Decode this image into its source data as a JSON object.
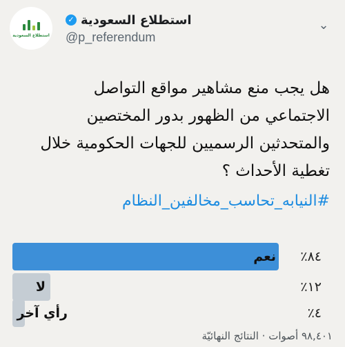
{
  "account": {
    "name": "استطلاع السعودية",
    "handle": "@p_referendum",
    "logo_text": "استطلاع السعودية",
    "verified_icon": "verified-badge-icon",
    "menu_icon": "chevron-down-icon"
  },
  "tweet": {
    "question_lines": [
      "هل يجب منع مشاهير مواقع التواصل",
      "الاجتماعي من الظهور بدور المختصين",
      "والمتحدثين الرسميين للجهات الحكومية خلال",
      "تغطية الأحداث ؟"
    ],
    "hashtag": "#النيابه_تحاسب_مخالفين_النظام"
  },
  "poll": {
    "options": [
      {
        "label": "نعم",
        "percent_label": "٨٤٪",
        "percent": 84,
        "winner": true
      },
      {
        "label": "لا",
        "percent_label": "١٢٪",
        "percent": 12,
        "winner": false
      },
      {
        "label": "رأي آخر",
        "percent_label": "٤٪",
        "percent": 4,
        "winner": false
      }
    ],
    "summary": "٩٨,٤٠١ أصوات · النتائج النهائيّة"
  },
  "colors": {
    "winner_bar": "#3d8fd8",
    "other_bar": "#c5cdd4",
    "hashtag": "#1b8be0",
    "verified": "#1d9bf0",
    "logo_green": "#2b8a3e"
  }
}
